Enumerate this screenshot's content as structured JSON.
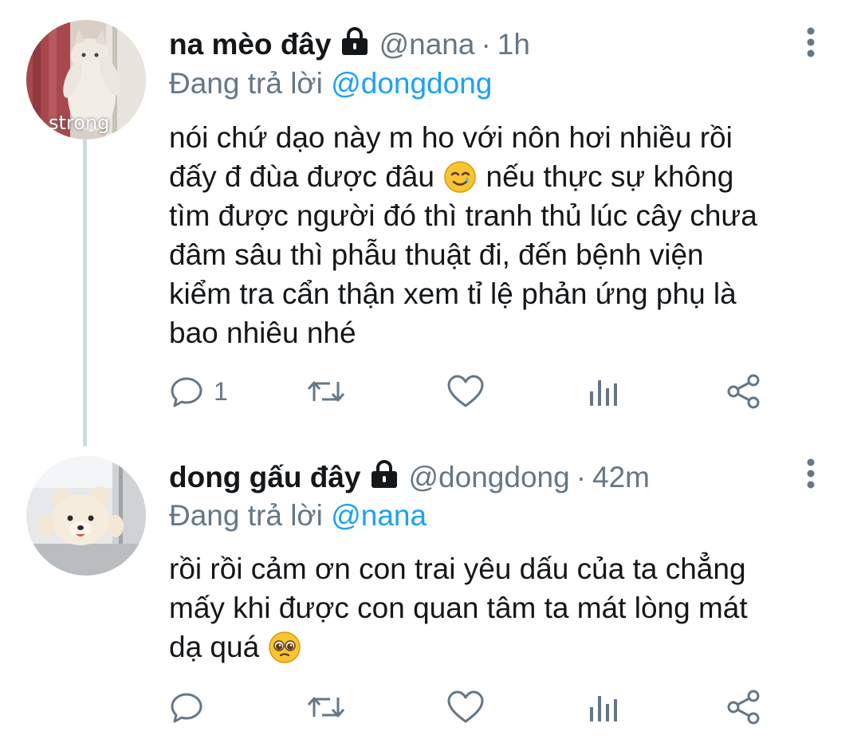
{
  "tweets": [
    {
      "display_name": "na mèo đây",
      "handle": "@nana",
      "separator": "·",
      "time": "1h",
      "replying_prefix": "Đang trả lời",
      "replying_to": "@dongdong",
      "avatar_caption": "strong",
      "text_before_emoji": "nói chứ dạo này m ho với nôn hơi nhiều rồi\nđấy đ đùa được đâu ",
      "emoji": "smiling-face-with-tear",
      "text_after_emoji": " nếu thực sự không\ntìm được người đó thì tranh thủ lúc cây chưa\nđâm sâu thì phẫu thuật đi, đến bệnh viện\nkiểm tra cẩn thận xem tỉ lệ phản ứng phụ là\nbao nhiêu nhé",
      "reply_count": "1",
      "icons": [
        "reply-icon",
        "retweet-icon",
        "like-icon",
        "analytics-icon",
        "share-icon"
      ]
    },
    {
      "display_name": "dong gấu đây",
      "handle": "@dongdong",
      "separator": "·",
      "time": "42m",
      "replying_prefix": "Đang trả lời",
      "replying_to": "@nana",
      "text_before_emoji": "rồi rồi cảm ơn con trai yêu dấu của ta chẳng\nmấy khi được con quan tâm ta mát lòng mát\ndạ quá ",
      "emoji": "pleading-face",
      "text_after_emoji": "",
      "reply_count": "",
      "icons": [
        "reply-icon",
        "retweet-icon",
        "like-icon",
        "analytics-icon",
        "share-icon"
      ]
    }
  ],
  "colors": {
    "text": "#14171a",
    "secondary": "#657786",
    "link": "#1da1f2",
    "thread_line": "#cfd9de"
  }
}
